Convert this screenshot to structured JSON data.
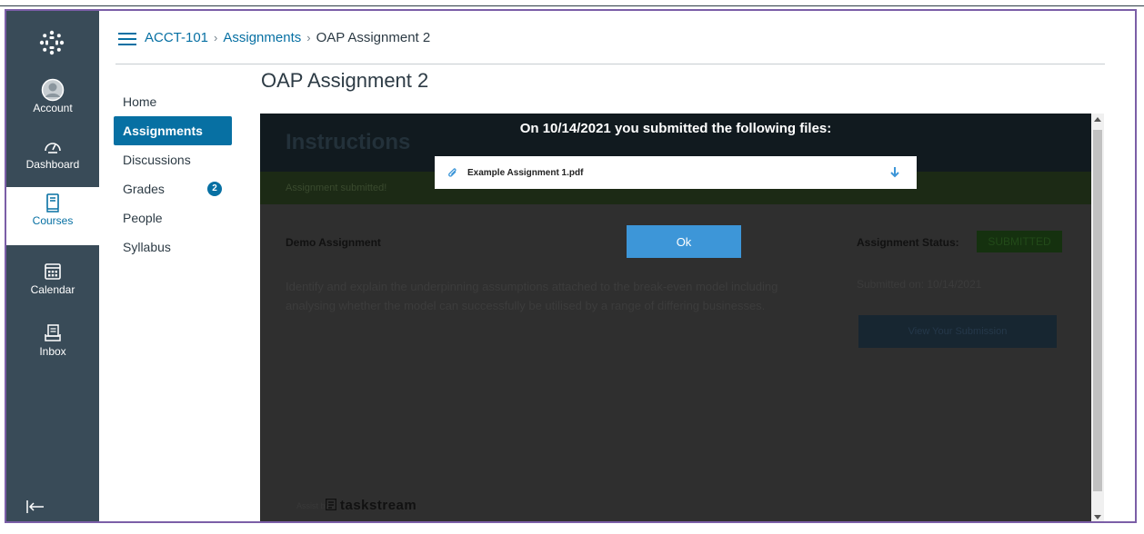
{
  "global_nav": {
    "items": [
      {
        "label": "Account",
        "icon": "account-icon"
      },
      {
        "label": "Dashboard",
        "icon": "dashboard-icon"
      },
      {
        "label": "Courses",
        "icon": "courses-icon"
      },
      {
        "label": "Calendar",
        "icon": "calendar-icon"
      },
      {
        "label": "Inbox",
        "icon": "inbox-icon"
      }
    ],
    "active": "Courses"
  },
  "breadcrumb": {
    "course": "ACCT-101",
    "section": "Assignments",
    "current": "OAP Assignment 2",
    "separator": "›"
  },
  "course_nav": {
    "items": [
      "Home",
      "Assignments",
      "Discussions",
      "Grades",
      "People",
      "Syllabus"
    ],
    "active": "Assignments",
    "grades_badge": "2"
  },
  "page_title": "OAP Assignment 2",
  "frame": {
    "instructions_heading": "Instructions",
    "submitted_banner": "Assignment submitted!",
    "demo_title": "Demo Assignment",
    "description": "Identify and explain the underpinning assumptions attached to the break-even model including analysing whether the model can successfully be utilised by a range of differing businesses.",
    "status_label": "Assignment Status:",
    "status_value": "SUBMITTED",
    "submitted_on": "Submitted on: 10/14/2021",
    "view_button": "View Your Submission",
    "powered_by": "Assist by",
    "brand": "taskstream"
  },
  "modal": {
    "title": "On 10/14/2021 you submitted the following files:",
    "file_name": "Example Assignment 1.pdf",
    "ok_label": "Ok"
  },
  "colors": {
    "nav_bg": "#394b58",
    "accent": "#0770a3",
    "ok_button": "#3d96d8",
    "frame_border": "#7b5ea7"
  }
}
